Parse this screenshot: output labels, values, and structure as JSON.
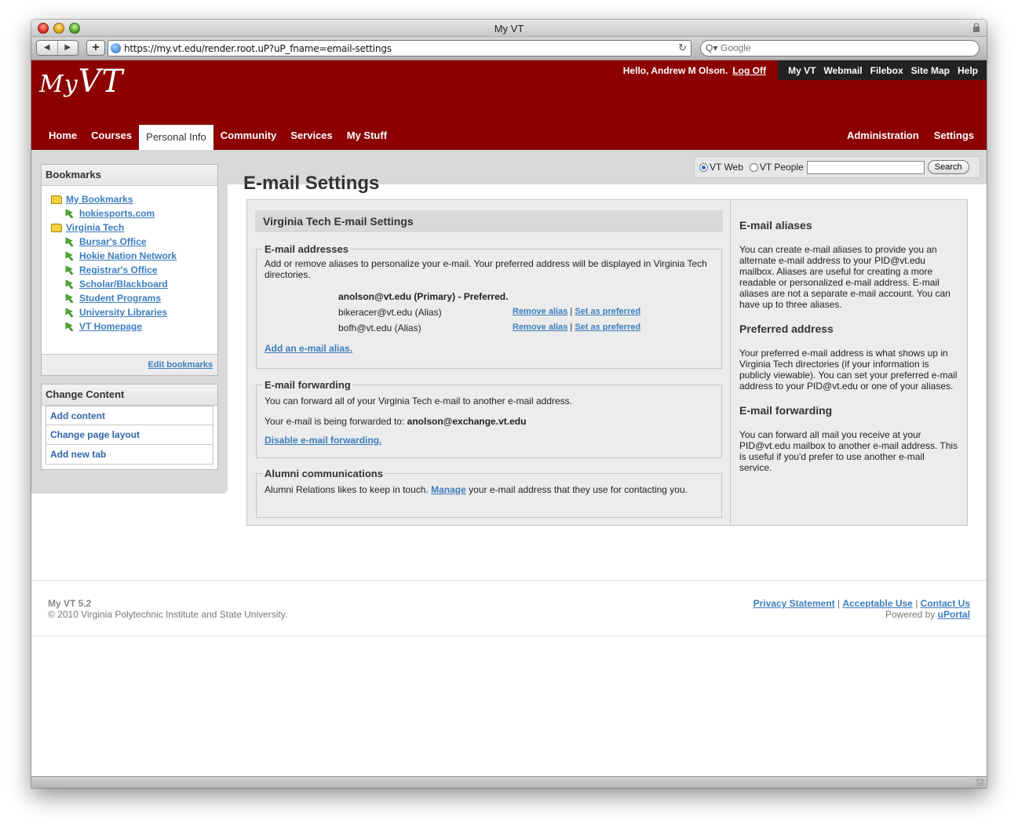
{
  "window": {
    "title": "My VT"
  },
  "browser": {
    "url": "https://my.vt.edu/render.root.uP?uP_fname=email-settings",
    "search_placeholder": "Google",
    "back_icon": "◀",
    "forward_icon": "▶",
    "add_icon": "+",
    "reload_icon": "↻",
    "search_icon": "Q▾"
  },
  "header": {
    "logo_my": "My",
    "logo_vt": "VT",
    "greeting": "Hello, Andrew M Olson.",
    "logoff": "Log Off",
    "top_links": [
      "My VT",
      "Webmail",
      "Filebox",
      "Site Map",
      "Help"
    ],
    "tabs": [
      "Home",
      "Courses",
      "Personal Info",
      "Community",
      "Services",
      "My Stuff"
    ],
    "active_tab": "Personal Info",
    "right_tabs": [
      "Administration",
      "Settings"
    ]
  },
  "search": {
    "option1": "VT Web",
    "option2": "VT People",
    "selected": "VT Web",
    "button": "Search"
  },
  "bookmarks": {
    "title": "Bookmarks",
    "folder1": "My Bookmarks",
    "folder1_items": [
      "hokiesports.com"
    ],
    "folder2": "Virginia Tech",
    "folder2_items": [
      "Bursar's Office",
      "Hokie Nation Network",
      "Registrar's Office",
      "Scholar/Blackboard",
      "Student Programs",
      "University Libraries",
      "VT Homepage"
    ],
    "edit": "Edit bookmarks"
  },
  "change_content": {
    "title": "Change Content",
    "items": [
      "Add content",
      "Change page layout",
      "Add new tab"
    ]
  },
  "main": {
    "title": "E-mail Settings",
    "section_title": "Virginia Tech E-mail Settings",
    "addresses": {
      "legend": "E-mail addresses",
      "intro": "Add or remove aliases to personalize your e-mail. Your preferred address will be displayed in Virginia Tech directories.",
      "primary_addr": "anolson@vt.edu",
      "primary_tag": "(Primary) - Preferred.",
      "aliases": [
        {
          "addr": "bikeracer@vt.edu",
          "tag": "(Alias)"
        },
        {
          "addr": "bofh@vt.edu",
          "tag": "(Alias)"
        }
      ],
      "remove_label": "Remove alias",
      "sep": "|",
      "preferred_label": "Set as preferred",
      "add_alias": "Add an e-mail alias."
    },
    "forwarding": {
      "legend": "E-mail forwarding",
      "intro": "You can forward all of your Virginia Tech e-mail to another e-mail address.",
      "status_label": "Your e-mail is being forwarded to:",
      "status_addr": "anolson@exchange.vt.edu",
      "disable": "Disable e-mail forwarding."
    },
    "alumni": {
      "legend": "Alumni communications",
      "text_before": "Alumni Relations likes to keep in touch.",
      "link": "Manage",
      "text_after": "your e-mail address that they use for contacting you."
    }
  },
  "help": {
    "aliases_title": "E-mail aliases",
    "aliases_text": "You can create e-mail aliases to provide you an alternate e-mail address to your PID@vt.edu mailbox. Aliases are useful for creating a more readable or personalized e-mail address. E-mail aliases are not a separate e-mail account. You can have up to three aliases.",
    "preferred_title": "Preferred address",
    "preferred_text": "Your preferred e-mail address is what shows up in Virginia Tech directories (if your information is publicly viewable). You can set your preferred e-mail address to your PID@vt.edu or one of your aliases.",
    "forwarding_title": "E-mail forwarding",
    "forwarding_text": "You can forward all mail you receive at your PID@vt.edu mailbox to another e-mail address. This is useful if you'd prefer to use another e-mail service."
  },
  "footer": {
    "version": "My VT 5.2",
    "copyright": "© 2010 Virginia Polytechnic Institute and State University.",
    "links": [
      "Privacy Statement",
      "Acceptable Use",
      "Contact Us"
    ],
    "sep": "|",
    "powered": "Powered by",
    "powered_link": "uPortal"
  },
  "colors": {
    "brand": "#8c0000",
    "link": "#3c7dbe",
    "panel": "#ececec"
  }
}
